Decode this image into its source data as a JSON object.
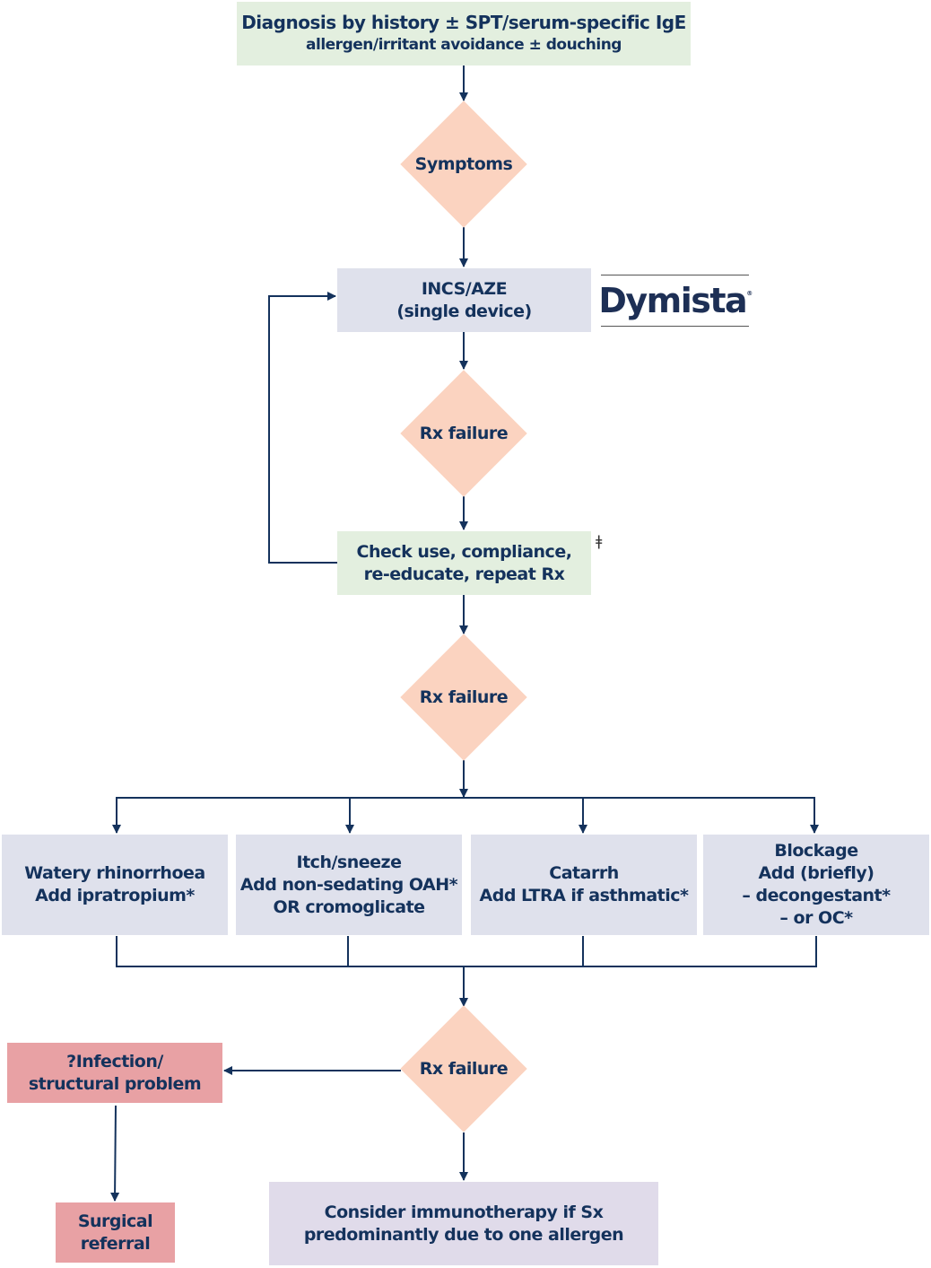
{
  "colors": {
    "text": "#14325c",
    "green": "#e3efdf",
    "grey": "#dfe1ec",
    "diamond": "#fbd3c0",
    "pink": "#e8a1a4",
    "purple": "#e0dbea"
  },
  "nodes": {
    "diagnosis": {
      "line1": "Diagnosis by history ± SPT/serum-specific IgE",
      "line2": "allergen/irritant avoidance ± douching"
    },
    "symptoms": "Symptoms",
    "incs": {
      "line1": "INCS/AZE",
      "line2": "(single device)"
    },
    "logo": "Dymista",
    "rx_failure_1": "Rx failure",
    "check": {
      "line1": "Check use, compliance,",
      "line2": "re-educate, repeat Rx"
    },
    "dagger": "ǂ",
    "rx_failure_2": "Rx failure",
    "branches": [
      {
        "lines": [
          "Watery rhinorrhoea",
          "Add ipratropium*"
        ]
      },
      {
        "lines": [
          "Itch/sneeze",
          "Add non-sedating OAH*",
          "OR cromoglicate"
        ]
      },
      {
        "lines": [
          "Catarrh",
          "Add LTRA if asthmatic*"
        ]
      },
      {
        "lines": [
          "Blockage",
          "Add (briefly)",
          "– decongestant*",
          "– or OC*"
        ]
      }
    ],
    "rx_failure_3": "Rx failure",
    "infection": {
      "line1": "?Infection/",
      "line2": "structural problem"
    },
    "surgical": {
      "line1": "Surgical",
      "line2": "referral"
    },
    "immunotherapy": {
      "line1": "Consider immunotherapy if Sx",
      "line2": "predominantly due to one allergen"
    }
  }
}
